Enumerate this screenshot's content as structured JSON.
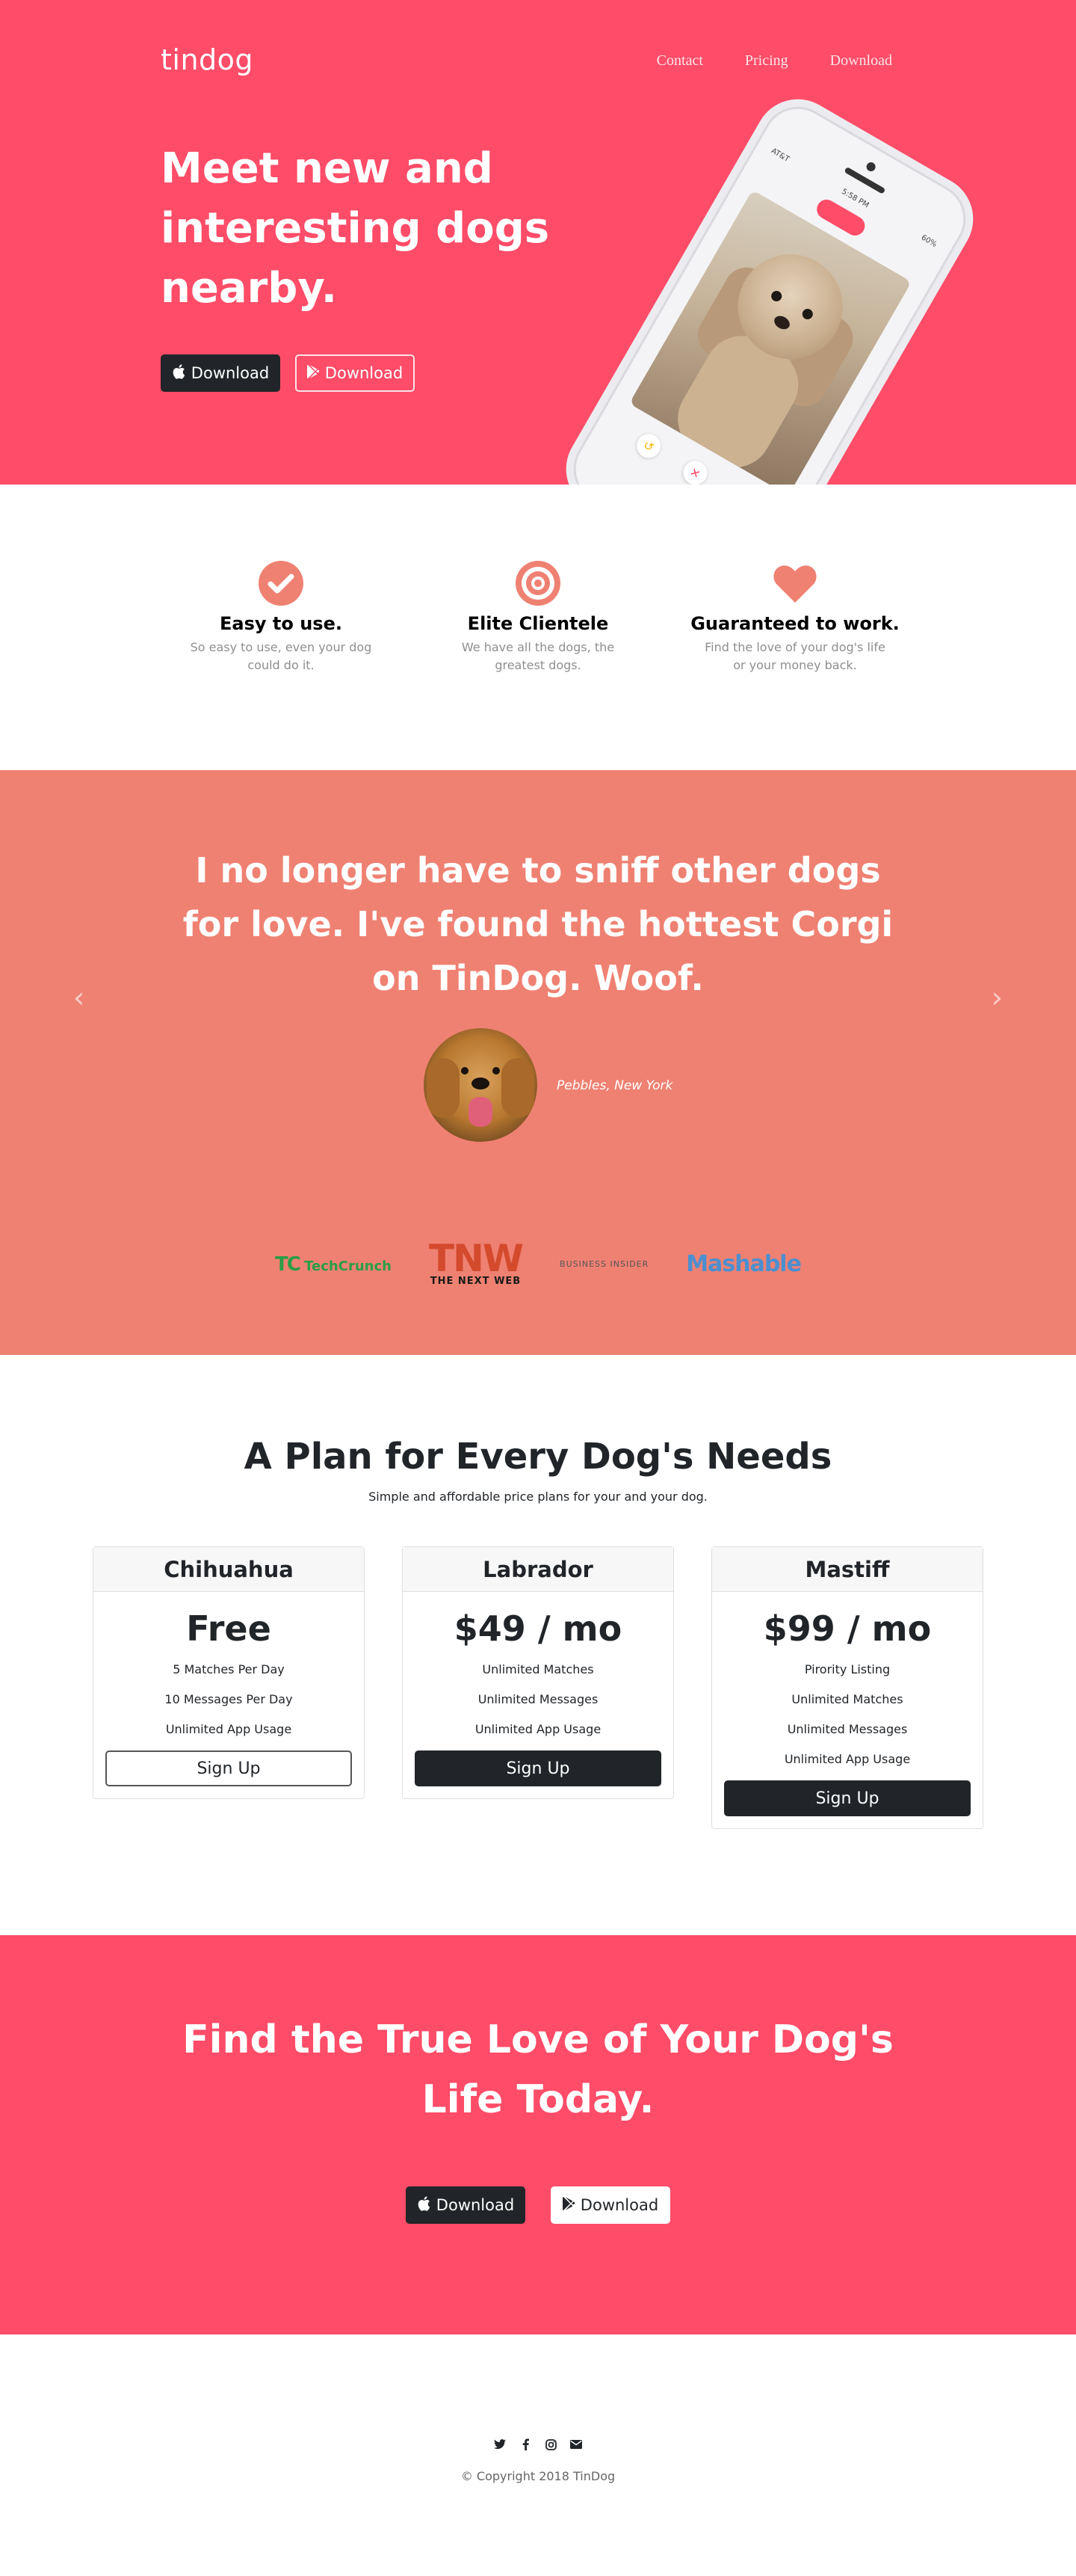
{
  "nav": {
    "brand": "tindog",
    "links": [
      "Contact",
      "Pricing",
      "Download"
    ]
  },
  "hero": {
    "title": "Meet new and interesting dogs nearby.",
    "apple_btn": "Download",
    "play_btn": "Download",
    "phone": {
      "carrier": "AT&T",
      "time": "5:58 PM",
      "battery": "60%"
    }
  },
  "features": [
    {
      "icon": "check-circle-icon",
      "title": "Easy to use.",
      "text": "So easy to use, even your dog could do it."
    },
    {
      "icon": "bullseye-icon",
      "title": "Elite Clientele",
      "text": "We have all the dogs, the greatest dogs."
    },
    {
      "icon": "heart-icon",
      "title": "Guaranteed to work.",
      "text": "Find the love of your dog's life or your money back."
    }
  ],
  "testimonial": {
    "quote": "I no longer have to sniff other dogs for love. I've found the hottest Corgi on TinDog. Woof.",
    "author": "Pebbles, New York"
  },
  "press": {
    "techcrunch": "TechCrunch",
    "tnw_big": "TNW",
    "tnw_small": "THE NEXT WEB",
    "business_insider": "BUSINESS INSIDER",
    "mashable": "Mashable"
  },
  "pricing": {
    "title": "A Plan for Every Dog's Needs",
    "subtitle": "Simple and affordable price plans for your and your dog.",
    "plans": [
      {
        "name": "Chihuahua",
        "price": "Free",
        "features": [
          "5 Matches Per Day",
          "10 Messages Per Day",
          "Unlimited App Usage"
        ],
        "button": "Sign Up"
      },
      {
        "name": "Labrador",
        "price": "$49 / mo",
        "features": [
          "Unlimited Matches",
          "Unlimited Messages",
          "Unlimited App Usage"
        ],
        "button": "Sign Up"
      },
      {
        "name": "Mastiff",
        "price": "$99 / mo",
        "features": [
          "Pirority Listing",
          "Unlimited Matches",
          "Unlimited Messages",
          "Unlimited App Usage"
        ],
        "button": "Sign Up"
      }
    ]
  },
  "cta": {
    "title": "Find the True Love of Your Dog's Life Today.",
    "apple_btn": "Download",
    "play_btn": "Download"
  },
  "footer": {
    "socials": [
      "twitter-icon",
      "facebook-icon",
      "instagram-icon",
      "envelope-icon"
    ],
    "copyright": "© Copyright 2018 TinDog"
  },
  "colors": {
    "hero_bg": "#ff4c68",
    "testimonial_bg": "#ef8172",
    "icon_accent": "#ef8172",
    "dark_btn": "#212529"
  }
}
